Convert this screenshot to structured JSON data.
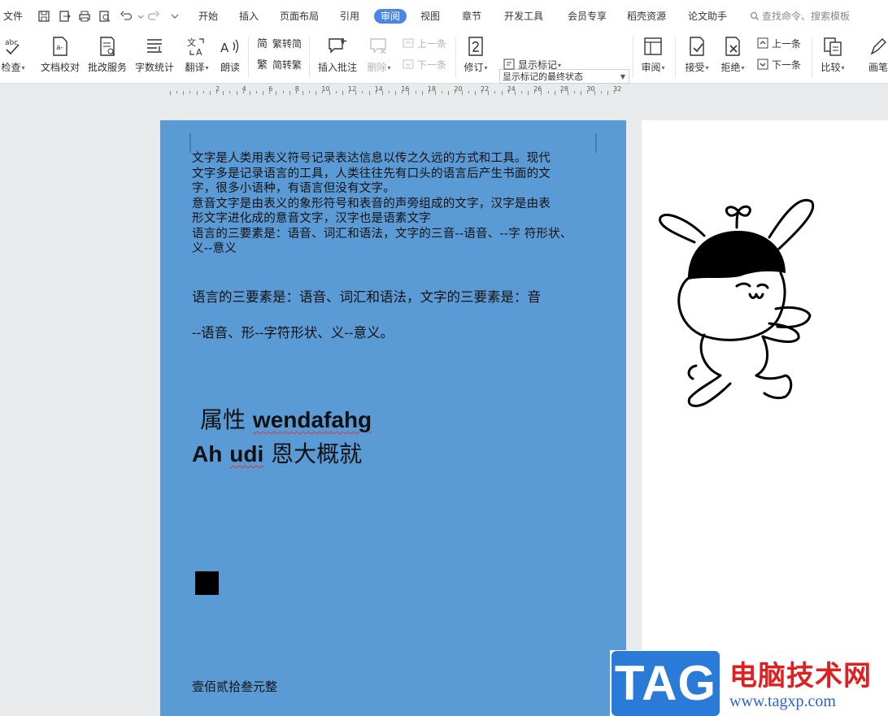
{
  "menubar": {
    "file": "文件",
    "tabs": [
      "开始",
      "插入",
      "页面布局",
      "引用",
      "审阅",
      "视图",
      "章节",
      "开发工具",
      "会员专享",
      "稻壳资源",
      "论文助手"
    ],
    "active_tab": "审阅",
    "search_placeholder": "查找命令、搜索模板"
  },
  "ribbon": {
    "spell_check": "检查",
    "doc_compare": "文档校对",
    "batch_service": "批改服务",
    "word_count": "字数统计",
    "translate": "翻译",
    "read_aloud": "朗读",
    "trad_simplified_to": "繁转简",
    "simplified_to_trad": "简转繁",
    "insert_comment": "插入批注",
    "delete": "删除",
    "prev_item": "上一条",
    "next_item": "下一条",
    "revise": "修订",
    "markup_state": "显示标记的最终状态",
    "show_markup": "显示标记",
    "review": "审阅",
    "accept": "接受",
    "reject": "拒绝",
    "prev_change": "上一条",
    "next_change": "下一条",
    "compare": "比较",
    "pen": "画笔"
  },
  "ruler": {
    "labels": [
      "2",
      "4",
      "6",
      "8",
      "10",
      "12",
      "14",
      "16",
      "18",
      "20",
      "22",
      "24",
      "26",
      "28",
      "30",
      "32"
    ]
  },
  "document": {
    "small_lines": [
      "文字是人类用表义符号记录表达信息以传之久远的方式和工具。现代",
      "文字多是记录语言的工具，人类往往先有口头的语言后产生书面的文",
      "字，很多小语种，有语言但没有文字。",
      "意音文字是由表义的象形符号和表音的声旁组成的文字，汉字是由表",
      "形文字进化成的意音文字，汉字也是语素文字",
      "语言的三要素是：语音、词汇和语法，文字的三音--语音、--字 符形状、",
      "义--意义"
    ],
    "serif_line1": "语言的三要素是：语音、词汇和语法，文字的三要素是：音",
    "serif_line2": "--语音、形--字符形状、义--意义。",
    "big_line1_cn": "属性",
    "big_line1_en": "wendafahg",
    "big_line2_en1": "Ah",
    "big_line2_en2": "udi",
    "big_line2_cn": "恩大概就",
    "bottom_text": "壹佰贰拾叁元整"
  },
  "watermark": {
    "logo": "TAG",
    "site_name": "电脑技术网",
    "url": "www.tagxp.com"
  },
  "colors": {
    "page_background": "#5b9bd5",
    "active_tab": "#4a86e8",
    "logo_blue": "#2a7bd8",
    "logo_red": "#e02020"
  }
}
